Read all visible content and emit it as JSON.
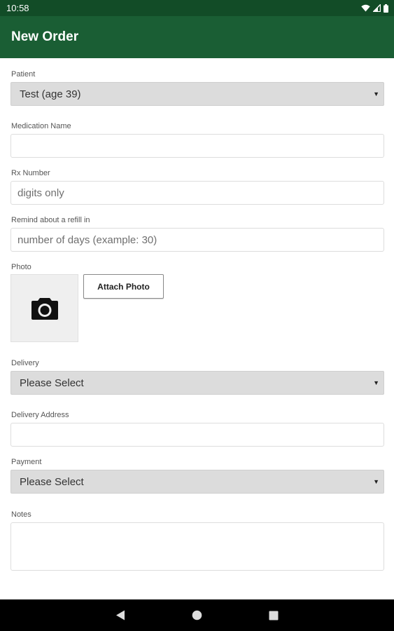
{
  "status_bar": {
    "time": "10:58"
  },
  "app_bar": {
    "title": "New Order"
  },
  "form": {
    "patient": {
      "label": "Patient",
      "value": "Test (age 39)"
    },
    "medication": {
      "label": "Medication Name",
      "value": "",
      "placeholder": ""
    },
    "rx_number": {
      "label": "Rx Number",
      "placeholder": "digits only"
    },
    "refill": {
      "label": "Remind about a refill in",
      "placeholder": "number of days (example: 30)"
    },
    "photo": {
      "label": "Photo",
      "attach_label": "Attach Photo"
    },
    "delivery": {
      "label": "Delivery",
      "value": "Please Select"
    },
    "delivery_address": {
      "label": "Delivery Address",
      "placeholder": ""
    },
    "payment": {
      "label": "Payment",
      "value": "Please Select"
    },
    "notes": {
      "label": "Notes",
      "placeholder": ""
    }
  },
  "colors": {
    "status_bar": "#124c27",
    "app_bar": "#1a5e34",
    "select_bg": "#dcdcdc",
    "nav_bar": "#000000"
  },
  "icons": {
    "status": [
      "wifi-icon",
      "signal-icon",
      "battery-icon"
    ],
    "photo": "camera-icon",
    "nav": [
      "back-icon",
      "home-icon",
      "recents-icon"
    ]
  }
}
